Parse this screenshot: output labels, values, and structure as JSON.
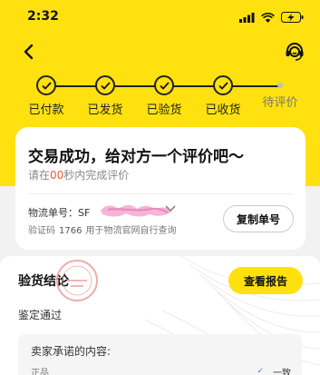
{
  "status_bar": {
    "time": "2:32"
  },
  "progress": {
    "steps": [
      {
        "label": "已付款",
        "done": true
      },
      {
        "label": "已发货",
        "done": true
      },
      {
        "label": "已验货",
        "done": true
      },
      {
        "label": "已收货",
        "done": true
      },
      {
        "label": "待评价",
        "done": false
      }
    ]
  },
  "order_card": {
    "title": "交易成功，给对方一个评价吧～",
    "subtitle_prefix": "请在",
    "subtitle_number": "00",
    "subtitle_suffix": "秒内完成评价",
    "tracking_label": "物流单号：SF",
    "verify_label": "验证码",
    "verify_code": "1766",
    "verify_note": "用于物流官网自行查询",
    "copy_button": "复制单号"
  },
  "inspection": {
    "title": "验货结论",
    "report_button": "查看报告",
    "result": "鉴定通过",
    "promise_title": "卖家承诺的内容:",
    "row_label": "正品",
    "row_value": "一致"
  },
  "colors": {
    "brand_yellow": "#ffe10f",
    "accent_red": "#ef5a2f"
  }
}
